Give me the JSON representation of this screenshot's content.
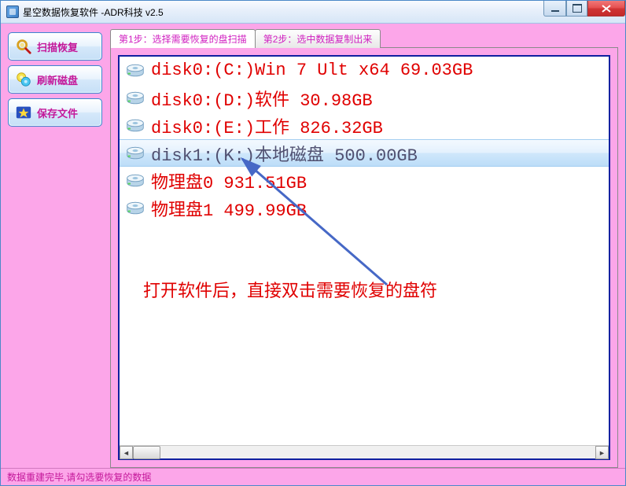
{
  "window": {
    "title": "星空数据恢复软件    -ADR科技 v2.5"
  },
  "sidebar": {
    "scan": "扫描恢复",
    "refresh": "刷新磁盘",
    "save": "保存文件"
  },
  "tabs": {
    "step1": "第1步：选择需要恢复的盘扫描",
    "step2": "第2步：选中数据复制出来",
    "active": 0
  },
  "drives": [
    {
      "text": "disk0:(C:)Win 7 Ult x64 69.03GB",
      "selected": false
    },
    {
      "text": "disk0:(D:)软件 30.98GB",
      "selected": false
    },
    {
      "text": "disk0:(E:)工作 826.32GB",
      "selected": false
    },
    {
      "text": "disk1:(K:)本地磁盘 500.00GB",
      "selected": true
    },
    {
      "text": "物理盘0 931.51GB",
      "selected": false
    },
    {
      "text": "物理盘1 499.99GB",
      "selected": false
    }
  ],
  "hint": "打开软件后，直接双击需要恢复的盘符",
  "status": "数据重建完毕,请勾选要恢复的数据"
}
